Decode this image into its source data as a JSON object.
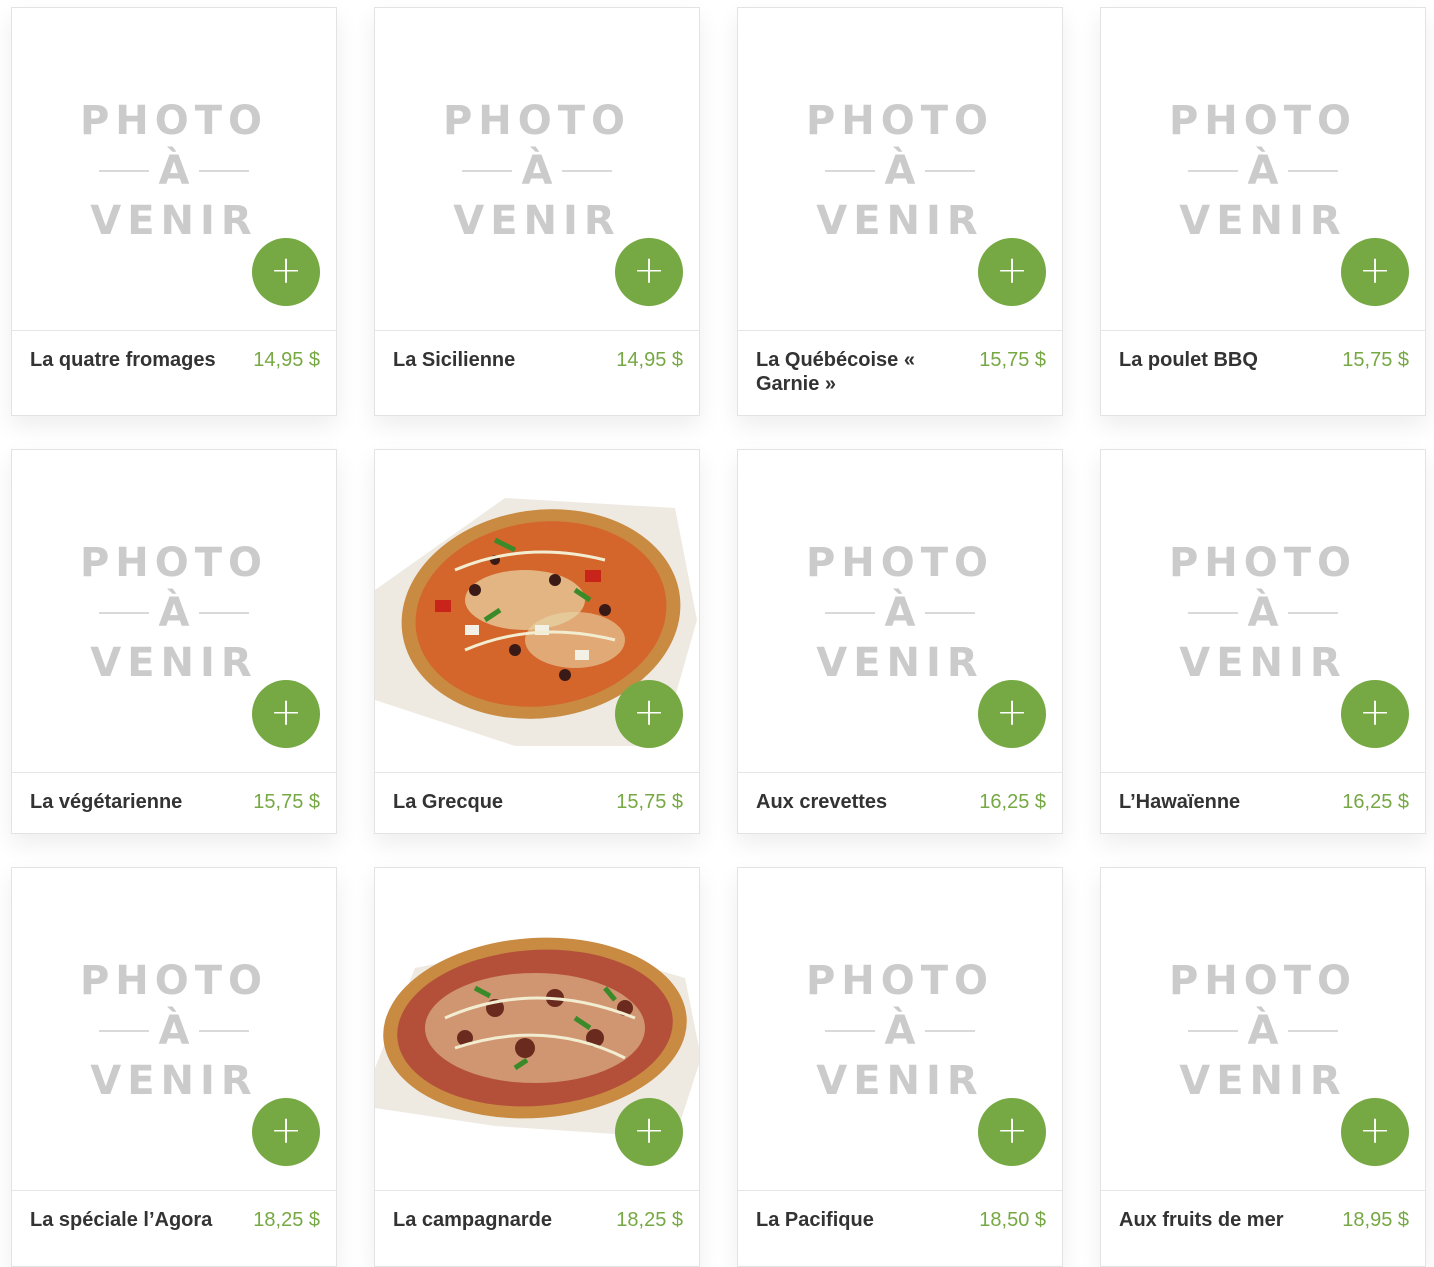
{
  "placeholder": {
    "line1": "PHOTO",
    "line2": "À",
    "line3": "VENIR"
  },
  "add_label": "+",
  "accent_color": "#76a843",
  "products": [
    {
      "name": "La quatre fromages",
      "price": "14,95 $"
    },
    {
      "name": "La Sicilienne",
      "price": "14,95 $"
    },
    {
      "name": "La Québécoise « Garnie »",
      "price": "15,75 $"
    },
    {
      "name": "La poulet BBQ",
      "price": "15,75 $"
    },
    {
      "name": "La végétarienne",
      "price": "15,75 $"
    },
    {
      "name": "La Grecque",
      "price": "15,75 $"
    },
    {
      "name": "Aux crevettes",
      "price": "16,25 $"
    },
    {
      "name": "L’Hawaïenne",
      "price": "16,25 $"
    },
    {
      "name": "La spéciale l’Agora",
      "price": "18,25 $"
    },
    {
      "name": "La campagnarde",
      "price": "18,25 $"
    },
    {
      "name": "La Pacifique",
      "price": "18,50 $"
    },
    {
      "name": "Aux fruits de mer",
      "price": "18,95 $"
    }
  ]
}
